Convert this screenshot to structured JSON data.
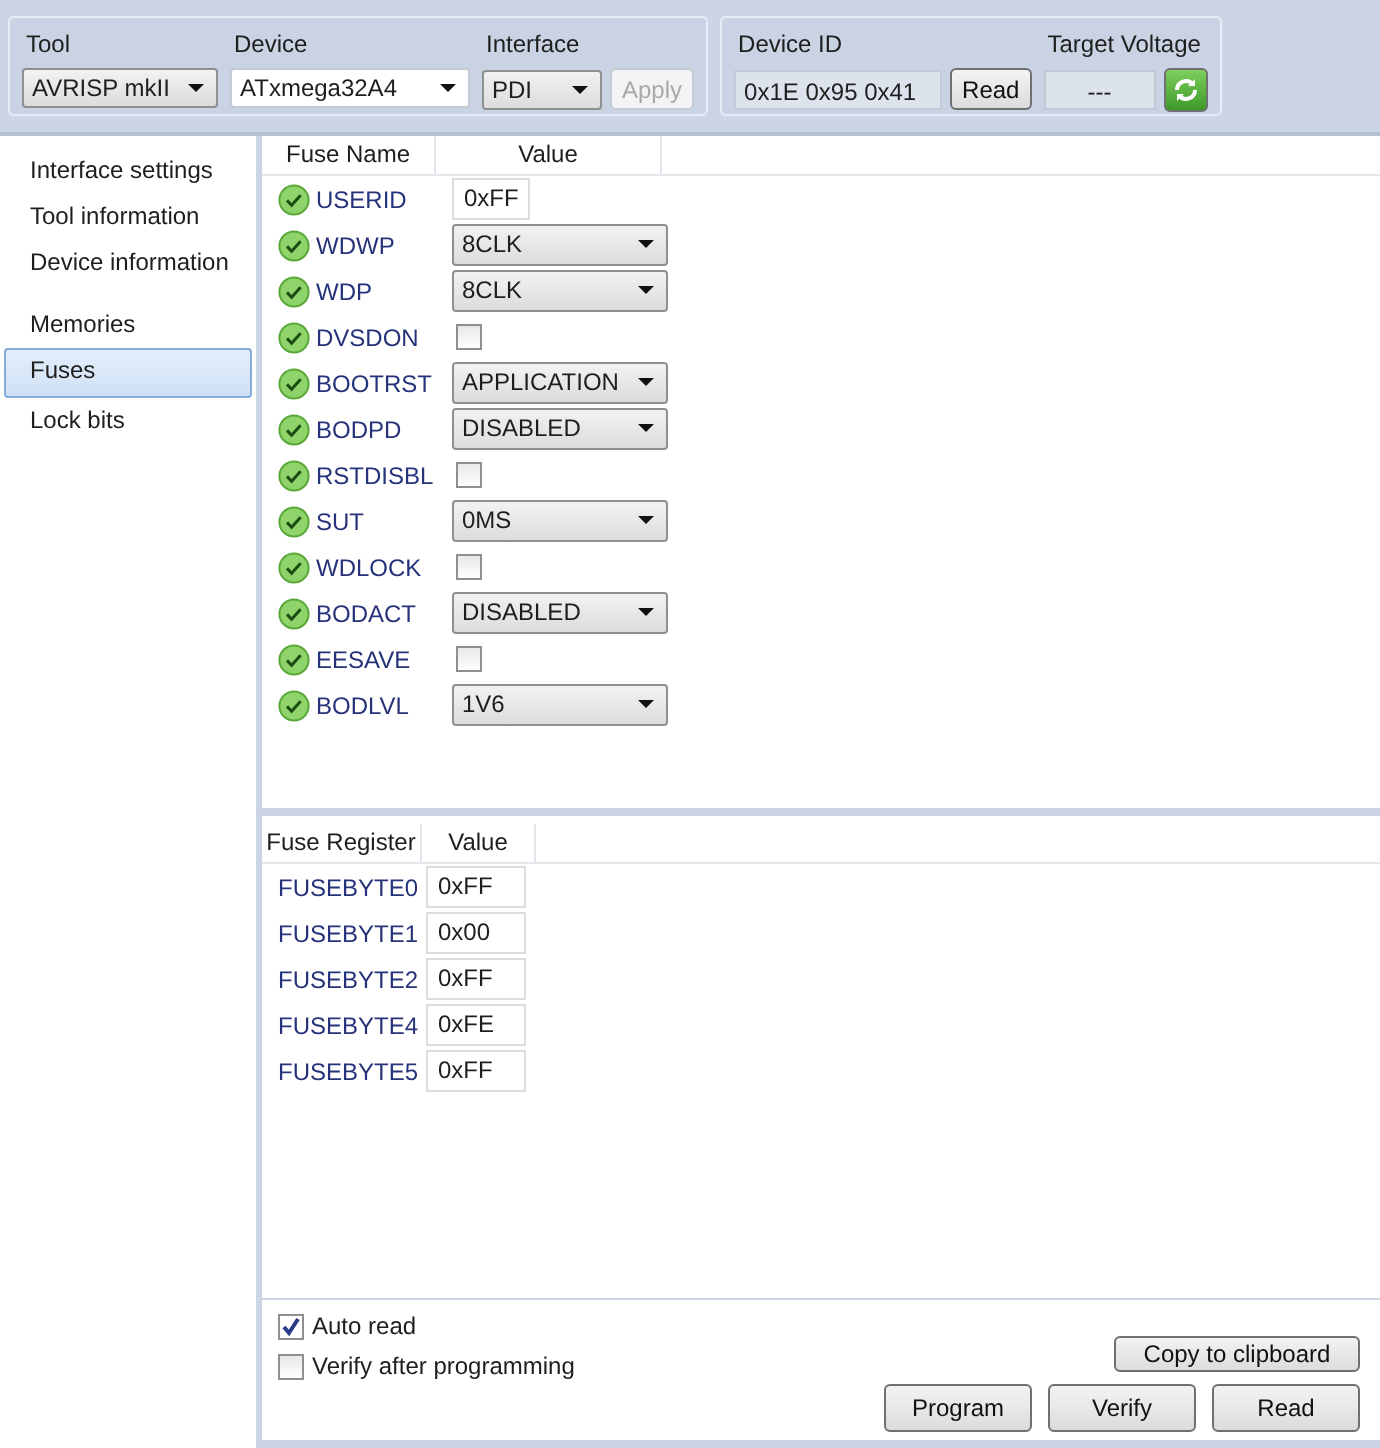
{
  "toolbar": {
    "tool": {
      "label": "Tool",
      "value": "AVRISP mkII"
    },
    "device": {
      "label": "Device",
      "value": "ATxmega32A4"
    },
    "interface": {
      "label": "Interface",
      "value": "PDI"
    },
    "apply_button": {
      "label": "Apply",
      "disabled": true
    },
    "device_id": {
      "label": "Device ID",
      "value": "0x1E 0x95 0x41",
      "read_button": "Read"
    },
    "target_voltage": {
      "label": "Target Voltage",
      "value": "---"
    }
  },
  "sidebar": {
    "groups": [
      [
        {
          "label": "Interface settings",
          "selected": false
        },
        {
          "label": "Tool information",
          "selected": false
        },
        {
          "label": "Device information",
          "selected": false
        }
      ],
      [
        {
          "label": "Memories",
          "selected": false
        },
        {
          "label": "Fuses",
          "selected": true
        },
        {
          "label": "Lock bits",
          "selected": false
        }
      ]
    ]
  },
  "fuses": {
    "columns": [
      "Fuse Name",
      "Value"
    ],
    "rows": [
      {
        "name": "USERID",
        "kind": "text",
        "value": "0xFF"
      },
      {
        "name": "WDWP",
        "kind": "select",
        "value": "8CLK"
      },
      {
        "name": "WDP",
        "kind": "select",
        "value": "8CLK"
      },
      {
        "name": "DVSDON",
        "kind": "checkbox",
        "checked": false
      },
      {
        "name": "BOOTRST",
        "kind": "select",
        "value": "APPLICATION"
      },
      {
        "name": "BODPD",
        "kind": "select",
        "value": "DISABLED"
      },
      {
        "name": "RSTDISBL",
        "kind": "checkbox",
        "checked": false
      },
      {
        "name": "SUT",
        "kind": "select",
        "value": "0MS"
      },
      {
        "name": "WDLOCK",
        "kind": "checkbox",
        "checked": false
      },
      {
        "name": "BODACT",
        "kind": "select",
        "value": "DISABLED"
      },
      {
        "name": "EESAVE",
        "kind": "checkbox",
        "checked": false
      },
      {
        "name": "BODLVL",
        "kind": "select",
        "value": "1V6"
      }
    ]
  },
  "registers": {
    "columns": [
      "Fuse Register",
      "Value"
    ],
    "rows": [
      {
        "name": "FUSEBYTE0",
        "value": "0xFF"
      },
      {
        "name": "FUSEBYTE1",
        "value": "0x00"
      },
      {
        "name": "FUSEBYTE2",
        "value": "0xFF"
      },
      {
        "name": "FUSEBYTE4",
        "value": "0xFE"
      },
      {
        "name": "FUSEBYTE5",
        "value": "0xFF"
      }
    ]
  },
  "options": [
    {
      "label": "Auto read",
      "checked": true
    },
    {
      "label": "Verify after programming",
      "checked": false
    }
  ],
  "copy_button": "Copy to clipboard",
  "action_buttons": [
    "Program",
    "Verify",
    "Read"
  ]
}
